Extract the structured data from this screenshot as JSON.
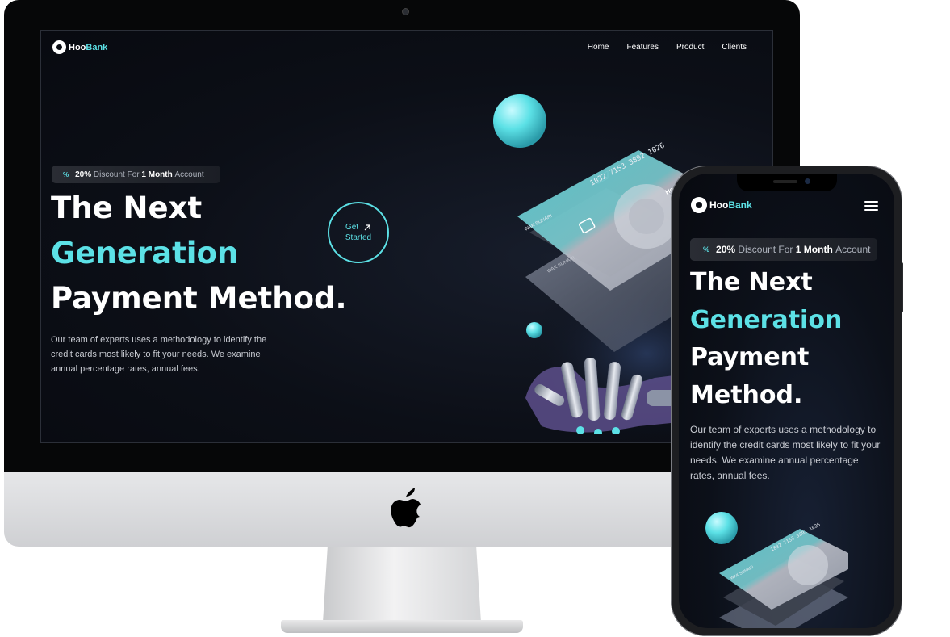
{
  "brand": {
    "name_prefix": "Hoo",
    "name_suffix": "Bank",
    "accent_color": "#5ce1e6"
  },
  "nav": {
    "items": [
      "Home",
      "Features",
      "Product",
      "Clients"
    ]
  },
  "badge": {
    "icon": "percent-icon",
    "pct": "20%",
    "discount": "Discount For",
    "one": "1",
    "month": "Month",
    "account": "Account"
  },
  "hero": {
    "line1": "The Next",
    "line2": "Generation",
    "line3": "Payment Method.",
    "mobile_line3": "Payment",
    "mobile_line4": "Method.",
    "description": "Our team of experts uses a methodology to identify the credit cards most likely to fit your needs. We examine annual percentage rates, annual fees.",
    "cta_line1": "Get",
    "cta_line2": "Started",
    "cta_icon": "arrow-up-right-icon"
  },
  "cards": {
    "number": "1832 7153 3892 1026",
    "holder": "WAK SUNARI",
    "brand": "HooBank"
  }
}
